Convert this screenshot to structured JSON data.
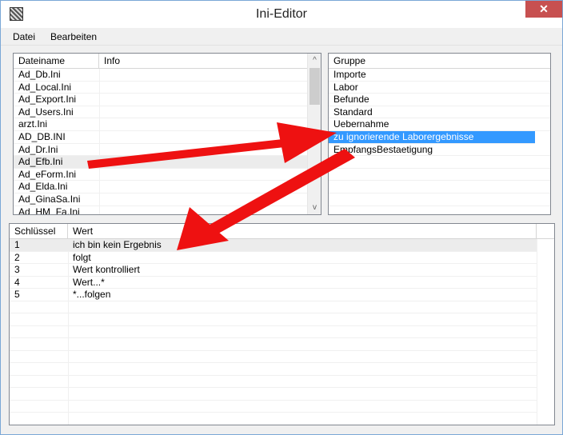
{
  "window": {
    "title": "Ini-Editor",
    "close_glyph": "✕"
  },
  "menu": [
    "Datei",
    "Bearbeiten"
  ],
  "files_panel": {
    "headers": [
      "Dateiname",
      "Info"
    ],
    "rows": [
      "Ad_Db.Ini",
      "Ad_Local.Ini",
      "Ad_Export.Ini",
      "Ad_Users.Ini",
      "arzt.Ini",
      "AD_DB.INI",
      "Ad_Dr.Ini",
      "Ad_Efb.Ini",
      "Ad_eForm.Ini",
      "Ad_Elda.Ini",
      "Ad_GinaSa.Ini",
      "Ad_HM_Fa.Ini"
    ],
    "selected_index": 7,
    "scroll_up": "^",
    "scroll_down": "v"
  },
  "groups_panel": {
    "header": "Gruppe",
    "rows": [
      "Importe",
      "Labor",
      "Befunde",
      "Standard",
      "Uebernahme",
      "zu ignorierende Laborergebnisse",
      "EmpfangsBestaetigung"
    ],
    "selected_index": 5
  },
  "values_panel": {
    "headers": [
      "Schlüssel",
      "Wert"
    ],
    "rows": [
      {
        "key": "1",
        "value": "ich bin kein Ergebnis"
      },
      {
        "key": "2",
        "value": "folgt"
      },
      {
        "key": "3",
        "value": "Wert kontrolliert"
      },
      {
        "key": "4",
        "value": "Wert...*"
      },
      {
        "key": "5",
        "value": "*...folgen"
      }
    ],
    "selected_index": 0
  },
  "colors": {
    "accent": "#3399ff",
    "arrow": "#ee1111",
    "close": "#c75050"
  }
}
